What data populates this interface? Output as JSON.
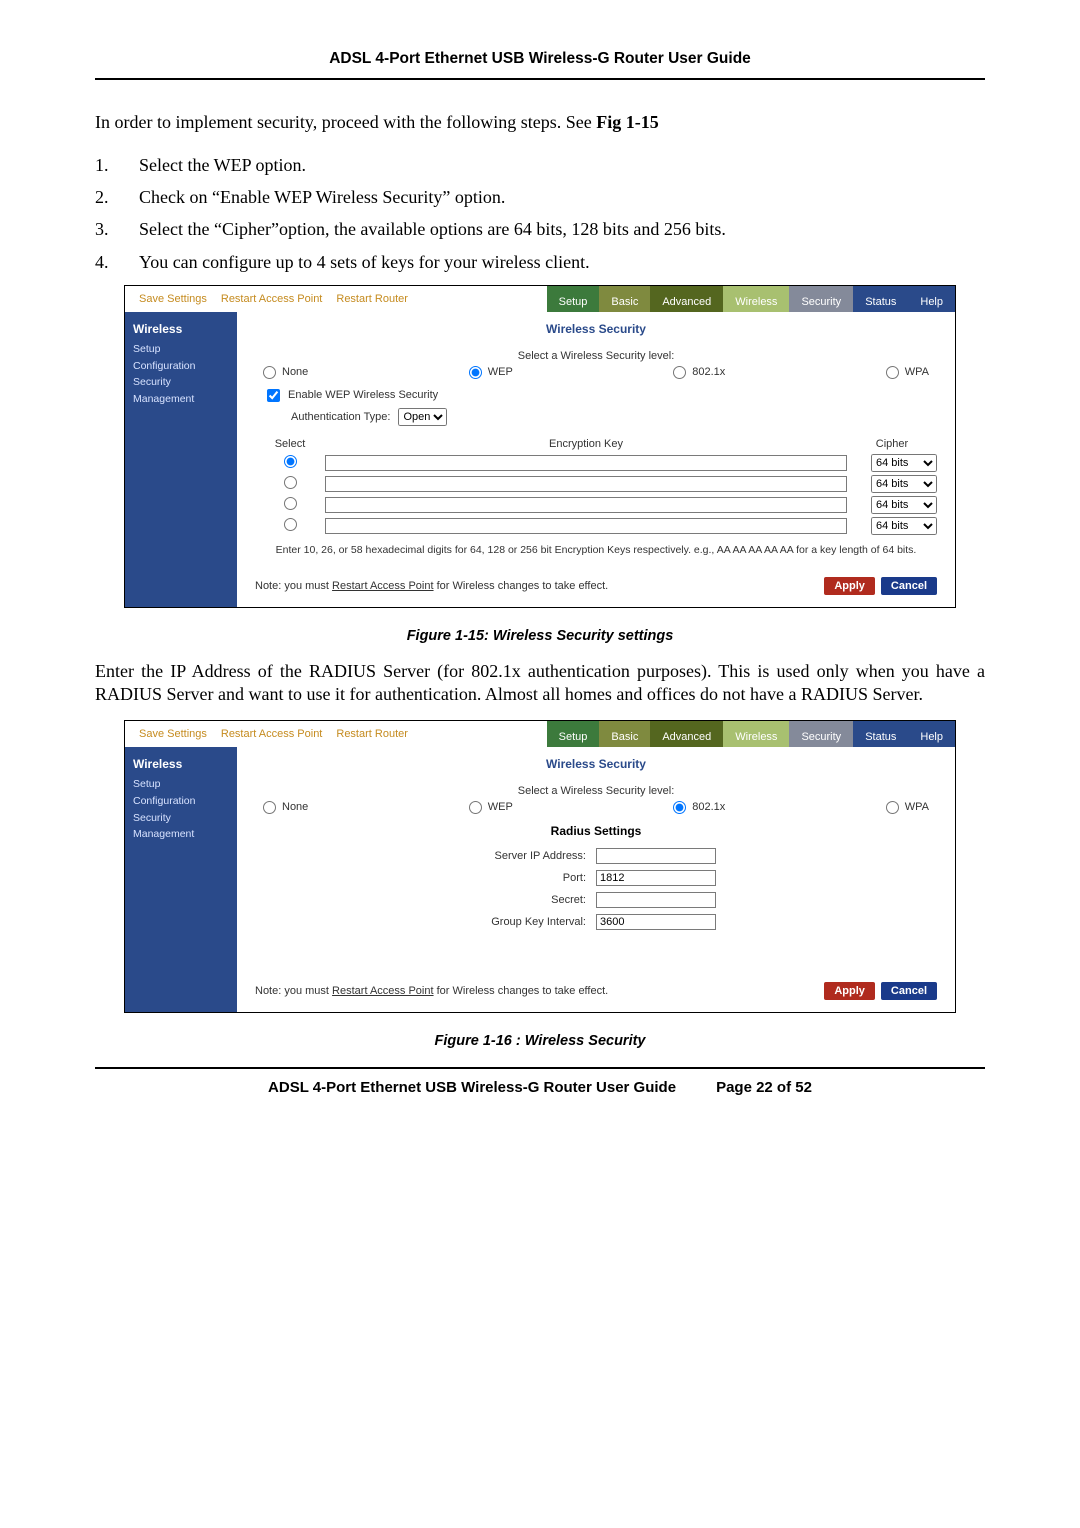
{
  "header": "ADSL 4-Port Ethernet USB Wireless-G Router User Guide",
  "intro": "In order to implement security, proceed with the following steps. See ",
  "intro_bold": "Fig 1-15",
  "steps": [
    "Select the WEP option.",
    "Check on “Enable WEP Wireless Security” option.",
    "Select the “Cipher”option, the available options are 64 bits, 128 bits and 256 bits.",
    "You can configure up to 4 sets of keys for your wireless client."
  ],
  "fig15_caption": "Figure 1-15: Wireless Security settings",
  "middle_paragraph": "Enter the IP Address of the RADIUS Server (for 802.1x authentication purposes). This is used only when you have a RADIUS Server and want to use it for authentication. Almost all homes and offices do not have a RADIUS Server.",
  "fig16_caption": "Figure 1-16 : Wireless Security",
  "footer_left": "ADSL 4-Port Ethernet USB Wireless-G Router User Guide",
  "footer_right": "Page 22 of 52",
  "router": {
    "topbar_links": {
      "save": "Save Settings",
      "restart_ap": "Restart Access Point",
      "restart_router": "Restart Router"
    },
    "tabs": {
      "setup": "Setup",
      "basic": "Basic",
      "advanced": "Advanced",
      "wireless": "Wireless",
      "security": "Security",
      "status": "Status",
      "help": "Help"
    },
    "sidebar": {
      "title": "Wireless",
      "links": {
        "setup": "Setup",
        "configuration": "Configuration",
        "security": "Security",
        "management": "Management"
      }
    },
    "section_title": "Wireless Security",
    "select_level": "Select a Wireless Security level:",
    "levels": {
      "none": "None",
      "wep": "WEP",
      "dot1x": "802.1x",
      "wpa": "WPA"
    },
    "enable_wep": "Enable WEP Wireless Security",
    "auth_type_label": "Authentication Type:",
    "auth_type_value": "Open",
    "key_headers": {
      "select": "Select",
      "key": "Encryption Key",
      "cipher": "Cipher"
    },
    "cipher_option": "64 bits",
    "key_hint": "Enter 10, 26, or 58 hexadecimal digits for 64, 128 or 256 bit Encryption Keys respectively. e.g., AA AA AA AA AA for a key length of 64 bits.",
    "footer_note_pre": "Note: you must ",
    "footer_note_link": "Restart Access Point",
    "footer_note_post": " for Wireless changes to take effect.",
    "apply": "Apply",
    "cancel": "Cancel",
    "radius_title": "Radius Settings",
    "radius_fields": {
      "server_ip": {
        "label": "Server IP Address:",
        "value": ""
      },
      "port": {
        "label": "Port:",
        "value": "1812"
      },
      "secret": {
        "label": "Secret:",
        "value": ""
      },
      "gki": {
        "label": "Group Key Interval:",
        "value": "3600"
      }
    }
  },
  "chart_data": {
    "type": "table",
    "title": "Wireless Security page state (two screenshots)",
    "screens": [
      {
        "selected_security_level": "WEP",
        "enable_wep_wireless_security": true,
        "authentication_type": "Open",
        "keys": [
          {
            "selected": true,
            "encryption_key": "",
            "cipher": "64 bits"
          },
          {
            "selected": false,
            "encryption_key": "",
            "cipher": "64 bits"
          },
          {
            "selected": false,
            "encryption_key": "",
            "cipher": "64 bits"
          },
          {
            "selected": false,
            "encryption_key": "",
            "cipher": "64 bits"
          }
        ]
      },
      {
        "selected_security_level": "802.1x",
        "radius": {
          "server_ip_address": "",
          "port": 1812,
          "secret": "",
          "group_key_interval": 3600
        }
      }
    ]
  }
}
